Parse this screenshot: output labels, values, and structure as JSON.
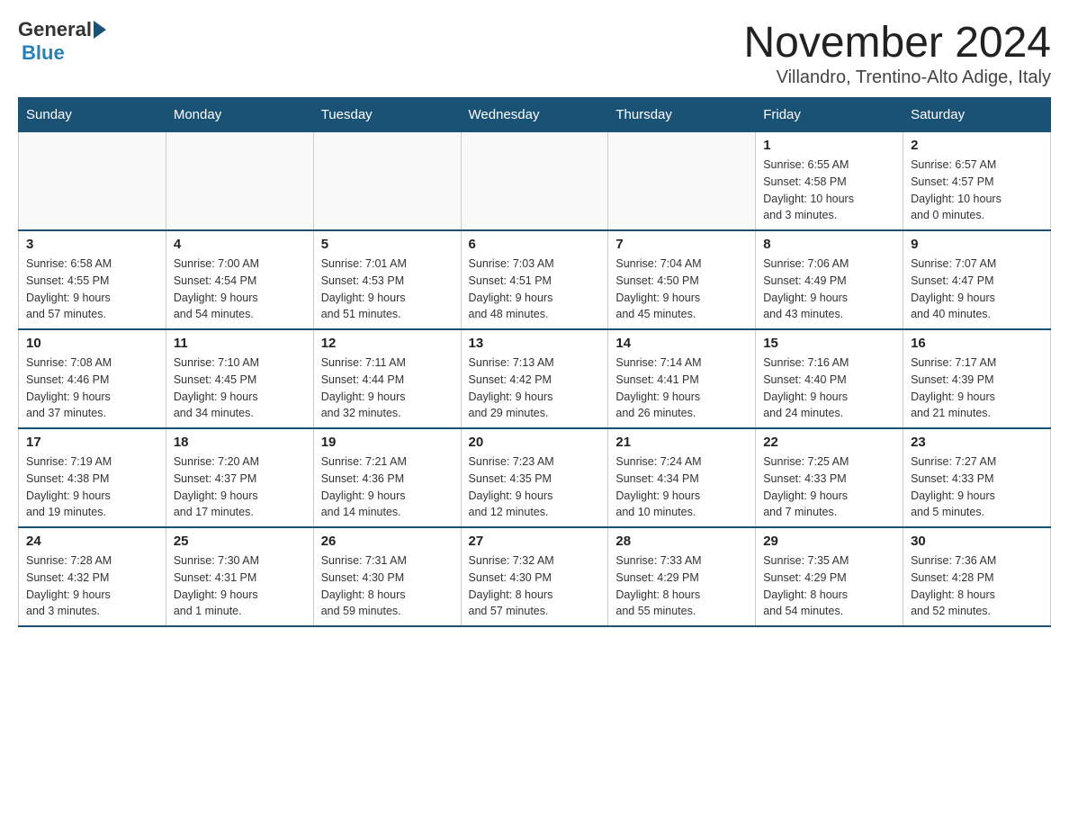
{
  "header": {
    "logo_general": "General",
    "logo_blue": "Blue",
    "month_title": "November 2024",
    "subtitle": "Villandro, Trentino-Alto Adige, Italy"
  },
  "weekdays": [
    "Sunday",
    "Monday",
    "Tuesday",
    "Wednesday",
    "Thursday",
    "Friday",
    "Saturday"
  ],
  "weeks": [
    [
      {
        "day": "",
        "info": ""
      },
      {
        "day": "",
        "info": ""
      },
      {
        "day": "",
        "info": ""
      },
      {
        "day": "",
        "info": ""
      },
      {
        "day": "",
        "info": ""
      },
      {
        "day": "1",
        "info": "Sunrise: 6:55 AM\nSunset: 4:58 PM\nDaylight: 10 hours\nand 3 minutes."
      },
      {
        "day": "2",
        "info": "Sunrise: 6:57 AM\nSunset: 4:57 PM\nDaylight: 10 hours\nand 0 minutes."
      }
    ],
    [
      {
        "day": "3",
        "info": "Sunrise: 6:58 AM\nSunset: 4:55 PM\nDaylight: 9 hours\nand 57 minutes."
      },
      {
        "day": "4",
        "info": "Sunrise: 7:00 AM\nSunset: 4:54 PM\nDaylight: 9 hours\nand 54 minutes."
      },
      {
        "day": "5",
        "info": "Sunrise: 7:01 AM\nSunset: 4:53 PM\nDaylight: 9 hours\nand 51 minutes."
      },
      {
        "day": "6",
        "info": "Sunrise: 7:03 AM\nSunset: 4:51 PM\nDaylight: 9 hours\nand 48 minutes."
      },
      {
        "day": "7",
        "info": "Sunrise: 7:04 AM\nSunset: 4:50 PM\nDaylight: 9 hours\nand 45 minutes."
      },
      {
        "day": "8",
        "info": "Sunrise: 7:06 AM\nSunset: 4:49 PM\nDaylight: 9 hours\nand 43 minutes."
      },
      {
        "day": "9",
        "info": "Sunrise: 7:07 AM\nSunset: 4:47 PM\nDaylight: 9 hours\nand 40 minutes."
      }
    ],
    [
      {
        "day": "10",
        "info": "Sunrise: 7:08 AM\nSunset: 4:46 PM\nDaylight: 9 hours\nand 37 minutes."
      },
      {
        "day": "11",
        "info": "Sunrise: 7:10 AM\nSunset: 4:45 PM\nDaylight: 9 hours\nand 34 minutes."
      },
      {
        "day": "12",
        "info": "Sunrise: 7:11 AM\nSunset: 4:44 PM\nDaylight: 9 hours\nand 32 minutes."
      },
      {
        "day": "13",
        "info": "Sunrise: 7:13 AM\nSunset: 4:42 PM\nDaylight: 9 hours\nand 29 minutes."
      },
      {
        "day": "14",
        "info": "Sunrise: 7:14 AM\nSunset: 4:41 PM\nDaylight: 9 hours\nand 26 minutes."
      },
      {
        "day": "15",
        "info": "Sunrise: 7:16 AM\nSunset: 4:40 PM\nDaylight: 9 hours\nand 24 minutes."
      },
      {
        "day": "16",
        "info": "Sunrise: 7:17 AM\nSunset: 4:39 PM\nDaylight: 9 hours\nand 21 minutes."
      }
    ],
    [
      {
        "day": "17",
        "info": "Sunrise: 7:19 AM\nSunset: 4:38 PM\nDaylight: 9 hours\nand 19 minutes."
      },
      {
        "day": "18",
        "info": "Sunrise: 7:20 AM\nSunset: 4:37 PM\nDaylight: 9 hours\nand 17 minutes."
      },
      {
        "day": "19",
        "info": "Sunrise: 7:21 AM\nSunset: 4:36 PM\nDaylight: 9 hours\nand 14 minutes."
      },
      {
        "day": "20",
        "info": "Sunrise: 7:23 AM\nSunset: 4:35 PM\nDaylight: 9 hours\nand 12 minutes."
      },
      {
        "day": "21",
        "info": "Sunrise: 7:24 AM\nSunset: 4:34 PM\nDaylight: 9 hours\nand 10 minutes."
      },
      {
        "day": "22",
        "info": "Sunrise: 7:25 AM\nSunset: 4:33 PM\nDaylight: 9 hours\nand 7 minutes."
      },
      {
        "day": "23",
        "info": "Sunrise: 7:27 AM\nSunset: 4:33 PM\nDaylight: 9 hours\nand 5 minutes."
      }
    ],
    [
      {
        "day": "24",
        "info": "Sunrise: 7:28 AM\nSunset: 4:32 PM\nDaylight: 9 hours\nand 3 minutes."
      },
      {
        "day": "25",
        "info": "Sunrise: 7:30 AM\nSunset: 4:31 PM\nDaylight: 9 hours\nand 1 minute."
      },
      {
        "day": "26",
        "info": "Sunrise: 7:31 AM\nSunset: 4:30 PM\nDaylight: 8 hours\nand 59 minutes."
      },
      {
        "day": "27",
        "info": "Sunrise: 7:32 AM\nSunset: 4:30 PM\nDaylight: 8 hours\nand 57 minutes."
      },
      {
        "day": "28",
        "info": "Sunrise: 7:33 AM\nSunset: 4:29 PM\nDaylight: 8 hours\nand 55 minutes."
      },
      {
        "day": "29",
        "info": "Sunrise: 7:35 AM\nSunset: 4:29 PM\nDaylight: 8 hours\nand 54 minutes."
      },
      {
        "day": "30",
        "info": "Sunrise: 7:36 AM\nSunset: 4:28 PM\nDaylight: 8 hours\nand 52 minutes."
      }
    ]
  ]
}
